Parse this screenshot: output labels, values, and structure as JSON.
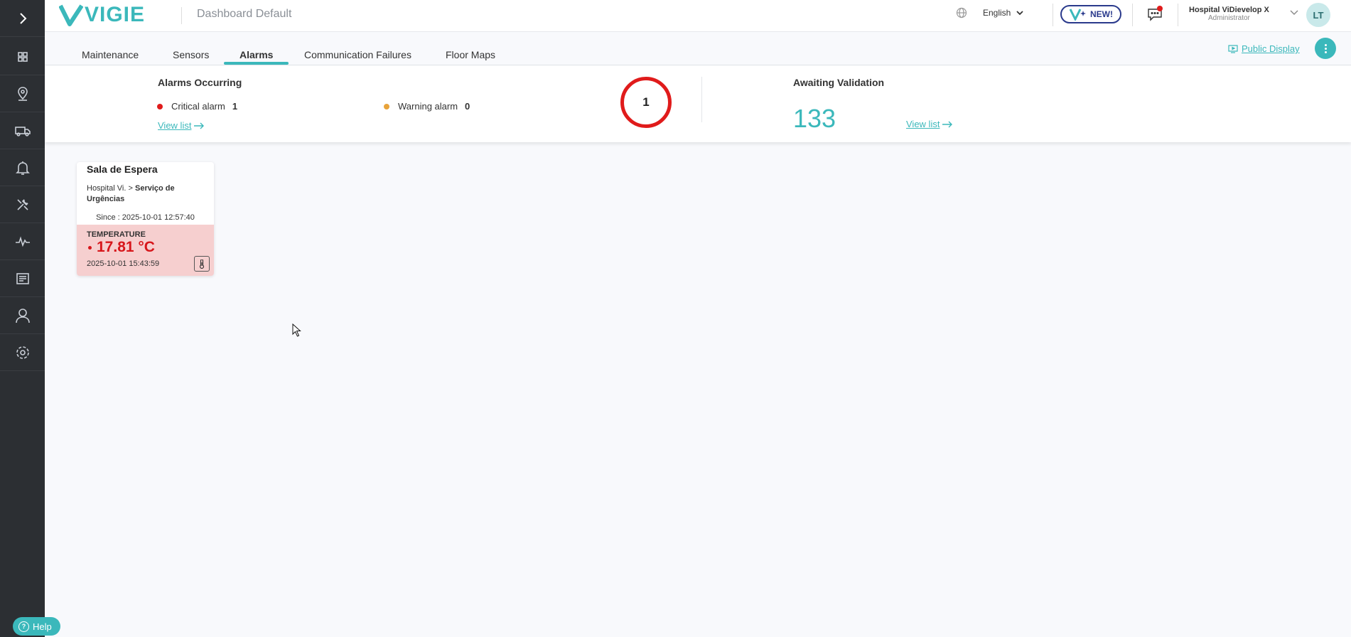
{
  "header": {
    "logo_text": "VIGIE",
    "dashboard_title": "Dashboard Default",
    "language": "English",
    "new_badge": "NEW!",
    "user_name": "Hospital ViDievelop X",
    "user_role": "Administrator",
    "avatar_initials": "LT"
  },
  "tabs": [
    {
      "label": "Maintenance"
    },
    {
      "label": "Sensors"
    },
    {
      "label": "Alarms",
      "active": true
    },
    {
      "label": "Communication Failures"
    },
    {
      "label": "Floor Maps"
    }
  ],
  "actions": {
    "public_display": "Public Display"
  },
  "summary": {
    "alarms_title": "Alarms Occurring",
    "critical_label": "Critical alarm",
    "critical_count": "1",
    "warning_label": "Warning alarm",
    "warning_count": "0",
    "view_list": "View list",
    "total_alarms": "1",
    "awaiting_title": "Awaiting Validation",
    "awaiting_count": "133",
    "awaiting_view_list": "View list"
  },
  "cards": [
    {
      "title": "Sala de Espera",
      "path_prefix": "Hospital Vi. >",
      "path_location": "Serviço de Urgências",
      "since": "Since : 2025-10-01 12:57:40",
      "metric_label": "TEMPERATURE",
      "metric_value": "17.81 °C",
      "metric_time": "2025-10-01 15:43:59"
    }
  ],
  "help": {
    "label": "Help"
  },
  "colors": {
    "accent": "#3bb8bb",
    "critical": "#e01b1b",
    "warning": "#e8a33a",
    "sidebar_bg": "#2c2f33",
    "alarm_card_bg": "#f6cfcf"
  },
  "icons": {
    "sidebar": [
      "chevron-right-icon",
      "dashboard-icon",
      "map-pin-icon",
      "truck-icon",
      "bell-icon",
      "tools-icon",
      "pulse-icon",
      "report-icon",
      "user-icon",
      "gear-icon"
    ]
  }
}
